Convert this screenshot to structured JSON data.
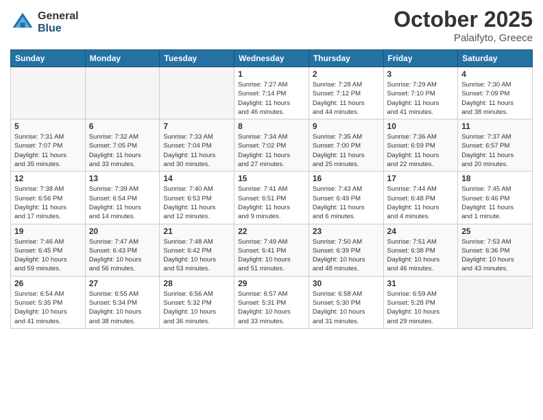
{
  "header": {
    "logo_general": "General",
    "logo_blue": "Blue",
    "month_title": "October 2025",
    "location": "Palaifyto, Greece"
  },
  "weekdays": [
    "Sunday",
    "Monday",
    "Tuesday",
    "Wednesday",
    "Thursday",
    "Friday",
    "Saturday"
  ],
  "weeks": [
    [
      {
        "day": "",
        "info": ""
      },
      {
        "day": "",
        "info": ""
      },
      {
        "day": "",
        "info": ""
      },
      {
        "day": "1",
        "info": "Sunrise: 7:27 AM\nSunset: 7:14 PM\nDaylight: 11 hours\nand 46 minutes."
      },
      {
        "day": "2",
        "info": "Sunrise: 7:28 AM\nSunset: 7:12 PM\nDaylight: 11 hours\nand 44 minutes."
      },
      {
        "day": "3",
        "info": "Sunrise: 7:29 AM\nSunset: 7:10 PM\nDaylight: 11 hours\nand 41 minutes."
      },
      {
        "day": "4",
        "info": "Sunrise: 7:30 AM\nSunset: 7:09 PM\nDaylight: 11 hours\nand 38 minutes."
      }
    ],
    [
      {
        "day": "5",
        "info": "Sunrise: 7:31 AM\nSunset: 7:07 PM\nDaylight: 11 hours\nand 35 minutes."
      },
      {
        "day": "6",
        "info": "Sunrise: 7:32 AM\nSunset: 7:05 PM\nDaylight: 11 hours\nand 33 minutes."
      },
      {
        "day": "7",
        "info": "Sunrise: 7:33 AM\nSunset: 7:04 PM\nDaylight: 11 hours\nand 30 minutes."
      },
      {
        "day": "8",
        "info": "Sunrise: 7:34 AM\nSunset: 7:02 PM\nDaylight: 11 hours\nand 27 minutes."
      },
      {
        "day": "9",
        "info": "Sunrise: 7:35 AM\nSunset: 7:00 PM\nDaylight: 11 hours\nand 25 minutes."
      },
      {
        "day": "10",
        "info": "Sunrise: 7:36 AM\nSunset: 6:59 PM\nDaylight: 11 hours\nand 22 minutes."
      },
      {
        "day": "11",
        "info": "Sunrise: 7:37 AM\nSunset: 6:57 PM\nDaylight: 11 hours\nand 20 minutes."
      }
    ],
    [
      {
        "day": "12",
        "info": "Sunrise: 7:38 AM\nSunset: 6:56 PM\nDaylight: 11 hours\nand 17 minutes."
      },
      {
        "day": "13",
        "info": "Sunrise: 7:39 AM\nSunset: 6:54 PM\nDaylight: 11 hours\nand 14 minutes."
      },
      {
        "day": "14",
        "info": "Sunrise: 7:40 AM\nSunset: 6:53 PM\nDaylight: 11 hours\nand 12 minutes."
      },
      {
        "day": "15",
        "info": "Sunrise: 7:41 AM\nSunset: 6:51 PM\nDaylight: 11 hours\nand 9 minutes."
      },
      {
        "day": "16",
        "info": "Sunrise: 7:43 AM\nSunset: 6:49 PM\nDaylight: 11 hours\nand 6 minutes."
      },
      {
        "day": "17",
        "info": "Sunrise: 7:44 AM\nSunset: 6:48 PM\nDaylight: 11 hours\nand 4 minutes."
      },
      {
        "day": "18",
        "info": "Sunrise: 7:45 AM\nSunset: 6:46 PM\nDaylight: 11 hours\nand 1 minute."
      }
    ],
    [
      {
        "day": "19",
        "info": "Sunrise: 7:46 AM\nSunset: 6:45 PM\nDaylight: 10 hours\nand 59 minutes."
      },
      {
        "day": "20",
        "info": "Sunrise: 7:47 AM\nSunset: 6:43 PM\nDaylight: 10 hours\nand 56 minutes."
      },
      {
        "day": "21",
        "info": "Sunrise: 7:48 AM\nSunset: 6:42 PM\nDaylight: 10 hours\nand 53 minutes."
      },
      {
        "day": "22",
        "info": "Sunrise: 7:49 AM\nSunset: 6:41 PM\nDaylight: 10 hours\nand 51 minutes."
      },
      {
        "day": "23",
        "info": "Sunrise: 7:50 AM\nSunset: 6:39 PM\nDaylight: 10 hours\nand 48 minutes."
      },
      {
        "day": "24",
        "info": "Sunrise: 7:51 AM\nSunset: 6:38 PM\nDaylight: 10 hours\nand 46 minutes."
      },
      {
        "day": "25",
        "info": "Sunrise: 7:53 AM\nSunset: 6:36 PM\nDaylight: 10 hours\nand 43 minutes."
      }
    ],
    [
      {
        "day": "26",
        "info": "Sunrise: 6:54 AM\nSunset: 5:35 PM\nDaylight: 10 hours\nand 41 minutes."
      },
      {
        "day": "27",
        "info": "Sunrise: 6:55 AM\nSunset: 5:34 PM\nDaylight: 10 hours\nand 38 minutes."
      },
      {
        "day": "28",
        "info": "Sunrise: 6:56 AM\nSunset: 5:32 PM\nDaylight: 10 hours\nand 36 minutes."
      },
      {
        "day": "29",
        "info": "Sunrise: 6:57 AM\nSunset: 5:31 PM\nDaylight: 10 hours\nand 33 minutes."
      },
      {
        "day": "30",
        "info": "Sunrise: 6:58 AM\nSunset: 5:30 PM\nDaylight: 10 hours\nand 31 minutes."
      },
      {
        "day": "31",
        "info": "Sunrise: 6:59 AM\nSunset: 5:28 PM\nDaylight: 10 hours\nand 29 minutes."
      },
      {
        "day": "",
        "info": ""
      }
    ]
  ]
}
